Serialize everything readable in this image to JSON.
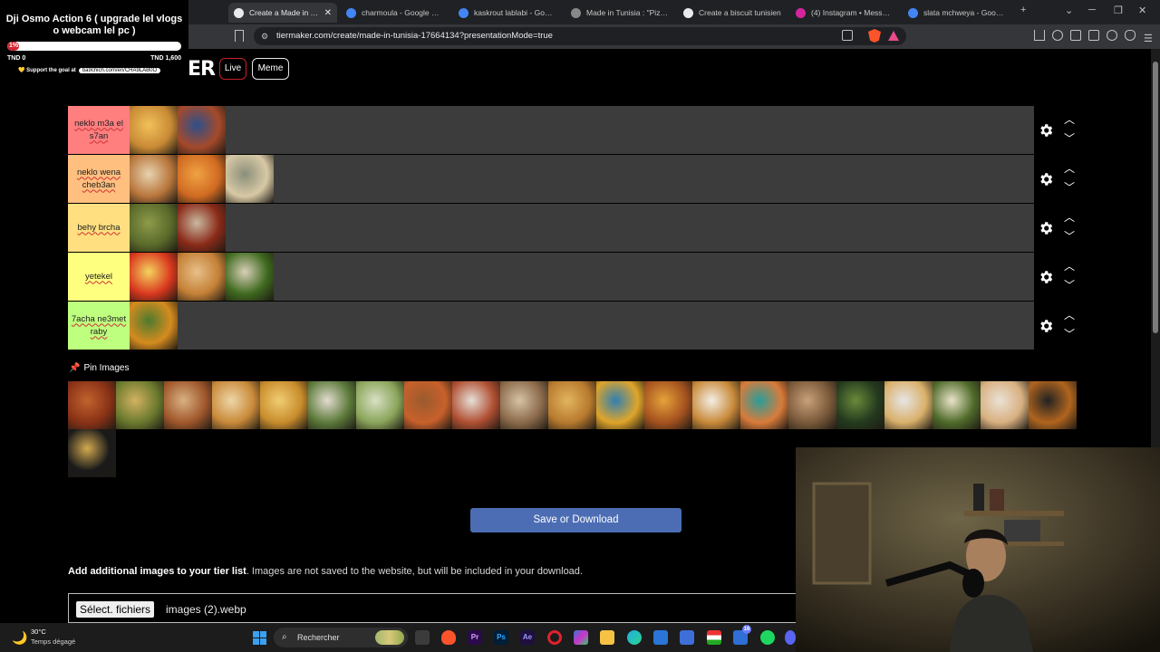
{
  "browser": {
    "tabs": [
      {
        "title": "Create a Made in Tunisia",
        "active": true,
        "favicon_color": "#e8eaed"
      },
      {
        "title": "charmoula - Google Search",
        "active": false,
        "favicon_color": "#4285f4"
      },
      {
        "title": "kaskrout lablabi - Google",
        "active": false,
        "favicon_color": "#4285f4"
      },
      {
        "title": "Made in Tunisia : \"Pizza L",
        "active": false,
        "favicon_color": "#888888"
      },
      {
        "title": "Create a biscuit tunisien",
        "active": false,
        "favicon_color": "#e8eaed"
      },
      {
        "title": "(4) Instagram • Messages",
        "active": false,
        "favicon_color": "#d6249f"
      },
      {
        "title": "slata mchweya - Google",
        "active": false,
        "favicon_color": "#4285f4"
      }
    ],
    "new_tab_symbol": "+",
    "url": "tiermaker.com/create/made-in-tunisia-17664134?presentationMode=true"
  },
  "stream_goal": {
    "title": "Dji Osmo Action 6 ( upgrade lel vlogs o webcam lel pc )",
    "progress_label": "1%",
    "progress_fraction": 0.01,
    "min_label": "TND 0",
    "max_label": "TND 1,600",
    "support_text": "💛 Support the goal at",
    "support_link": "ba9chich.com/en/CHA9LAB0O"
  },
  "page": {
    "logo_text": "ER",
    "nav": {
      "live": "Live",
      "meme": "Meme"
    },
    "tiers": [
      {
        "label": "neklo m3a el s7an",
        "color": "#ff7f7f",
        "items": [
          {
            "name": "food-couscous-plate",
            "c1": "#c98a35",
            "c2": "#f1c15a"
          },
          {
            "name": "food-fish-plate",
            "c1": "#a54a2a",
            "c2": "#2d4f8c"
          }
        ]
      },
      {
        "label": "neklo wena cheb3an",
        "color": "#ffbf7f",
        "items": [
          {
            "name": "food-roast-chicken",
            "c1": "#b8763c",
            "c2": "#e8d3b0"
          },
          {
            "name": "food-couscous-meat",
            "c1": "#d06a22",
            "c2": "#f0a343"
          },
          {
            "name": "food-chickpea-bowl",
            "c1": "#d8c9a5",
            "c2": "#8a8f7a"
          }
        ]
      },
      {
        "label": "behy brcha",
        "color": "#ffdf7f",
        "items": [
          {
            "name": "food-green-fritters",
            "c1": "#5a6a2a",
            "c2": "#8d9b4a"
          },
          {
            "name": "food-red-soup",
            "c1": "#8a2a18",
            "c2": "#c9b9a0"
          }
        ]
      },
      {
        "label": "yetekel",
        "color": "#ffff7f",
        "items": [
          {
            "name": "food-ojja-eggs",
            "c1": "#d9381e",
            "c2": "#f4d35e"
          },
          {
            "name": "food-stuffed-pastry",
            "c1": "#c48036",
            "c2": "#e7c089"
          },
          {
            "name": "food-green-peppers",
            "c1": "#3f6a1f",
            "c2": "#d9cfb8"
          }
        ]
      },
      {
        "label": "7acha ne3met raby",
        "color": "#bfff7f",
        "items": [
          {
            "name": "food-couscous-vegetables",
            "c1": "#d58b1f",
            "c2": "#4d7a2e"
          }
        ]
      }
    ],
    "pin_label": "Pin Images",
    "pool_images": [
      {
        "name": "pool-food-1",
        "c1": "#8a3216",
        "c2": "#c2632e"
      },
      {
        "name": "pool-food-2",
        "c1": "#6b7a2e",
        "c2": "#d4b262"
      },
      {
        "name": "pool-food-3",
        "c1": "#a0572b",
        "c2": "#d9b283"
      },
      {
        "name": "pool-food-4",
        "c1": "#c98a3a",
        "c2": "#eed7a8"
      },
      {
        "name": "pool-food-5",
        "c1": "#c88c2c",
        "c2": "#f1cd73"
      },
      {
        "name": "pool-food-6",
        "c1": "#5c7a3a",
        "c2": "#e3dcd0"
      },
      {
        "name": "pool-food-7",
        "c1": "#8aa55a",
        "c2": "#d8e0c4"
      },
      {
        "name": "pool-food-8",
        "c1": "#c8602b",
        "c2": "#9a5b2d"
      },
      {
        "name": "pool-food-9",
        "c1": "#b04f32",
        "c2": "#e6e0d8"
      },
      {
        "name": "pool-food-10",
        "c1": "#8b6a4a",
        "c2": "#d6c2a6"
      },
      {
        "name": "pool-food-11",
        "c1": "#b87a2e",
        "c2": "#e2b560"
      },
      {
        "name": "pool-food-12",
        "c1": "#e0a52a",
        "c2": "#2f7fb2"
      },
      {
        "name": "pool-food-13",
        "c1": "#a5521f",
        "c2": "#e6a23a"
      },
      {
        "name": "pool-food-14",
        "c1": "#c98a3a",
        "c2": "#f3efe7"
      },
      {
        "name": "pool-food-15",
        "c1": "#d97b3a",
        "c2": "#2a9d9a"
      },
      {
        "name": "pool-food-16",
        "c1": "#7a5a3a",
        "c2": "#c9a07a"
      },
      {
        "name": "pool-food-17",
        "c1": "#243a1e",
        "c2": "#6a8a3a"
      },
      {
        "name": "pool-food-18",
        "c1": "#d9b06a",
        "c2": "#e6e6e6"
      },
      {
        "name": "pool-food-19",
        "c1": "#4f6a2a",
        "c2": "#eae4c8"
      },
      {
        "name": "pool-food-20",
        "c1": "#d8b080",
        "c2": "#eae2d6"
      },
      {
        "name": "pool-food-21",
        "c1": "#b0641e",
        "c2": "#222222"
      },
      {
        "name": "pool-food-22",
        "c1": "#1a1a1a",
        "c2": "#d4aa50"
      }
    ],
    "save_button": "Save or Download",
    "add_images_bold": "Add additional images to your tier list",
    "add_images_rest": ". Images are not saved to the website, but will be included in your download.",
    "file_button": "Sélect. fichiers",
    "file_name": "images (2).webp"
  },
  "taskbar": {
    "temperature": "30°C",
    "weather": "Temps dégagé",
    "search_placeholder": "Rechercher",
    "spotify_badge": "16"
  }
}
